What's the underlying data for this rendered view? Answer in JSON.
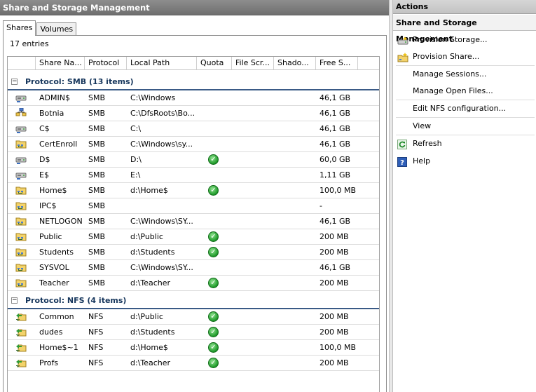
{
  "left_pane": {
    "title": "Share and Storage Management",
    "tabs": [
      {
        "label": "Shares",
        "active": true
      },
      {
        "label": "Volumes",
        "active": false
      }
    ],
    "entries_count": "17 entries"
  },
  "columns": [
    "Share Na...",
    "Protocol",
    "Local Path",
    "Quota",
    "File Scr...",
    "Shado...",
    "Free S..."
  ],
  "groups": [
    {
      "title": "Protocol: SMB (13 items)",
      "rows": [
        {
          "name": "ADMIN$",
          "protocol": "SMB",
          "path": "C:\\Windows",
          "quota": false,
          "free": "46,1 GB",
          "icon": "drive-share-icon"
        },
        {
          "name": "Botnia",
          "protocol": "SMB",
          "path": "C:\\DfsRoots\\Bo...",
          "quota": false,
          "free": "46,1 GB",
          "icon": "dfs-share-icon"
        },
        {
          "name": "C$",
          "protocol": "SMB",
          "path": "C:\\",
          "quota": false,
          "free": "46,1 GB",
          "icon": "drive-share-icon"
        },
        {
          "name": "CertEnroll",
          "protocol": "SMB",
          "path": "C:\\Windows\\sy...",
          "quota": false,
          "free": "46,1 GB",
          "icon": "folder-share-icon"
        },
        {
          "name": "D$",
          "protocol": "SMB",
          "path": "D:\\",
          "quota": true,
          "free": "60,0 GB",
          "icon": "drive-share-icon"
        },
        {
          "name": "E$",
          "protocol": "SMB",
          "path": "E:\\",
          "quota": false,
          "free": "1,11 GB",
          "icon": "drive-share-icon"
        },
        {
          "name": "Home$",
          "protocol": "SMB",
          "path": "d:\\Home$",
          "quota": true,
          "free": "100,0 MB",
          "icon": "folder-share-icon"
        },
        {
          "name": "IPC$",
          "protocol": "SMB",
          "path": "",
          "quota": false,
          "free": "-",
          "icon": "folder-share-icon"
        },
        {
          "name": "NETLOGON",
          "protocol": "SMB",
          "path": "C:\\Windows\\SY...",
          "quota": false,
          "free": "46,1 GB",
          "icon": "folder-share-icon"
        },
        {
          "name": "Public",
          "protocol": "SMB",
          "path": "d:\\Public",
          "quota": true,
          "free": "200 MB",
          "icon": "folder-share-icon"
        },
        {
          "name": "Students",
          "protocol": "SMB",
          "path": "d:\\Students",
          "quota": true,
          "free": "200 MB",
          "icon": "folder-share-icon"
        },
        {
          "name": "SYSVOL",
          "protocol": "SMB",
          "path": "C:\\Windows\\SY...",
          "quota": false,
          "free": "46,1 GB",
          "icon": "folder-share-icon"
        },
        {
          "name": "Teacher",
          "protocol": "SMB",
          "path": "d:\\Teacher",
          "quota": true,
          "free": "200 MB",
          "icon": "folder-share-icon"
        }
      ]
    },
    {
      "title": "Protocol: NFS (4 items)",
      "rows": [
        {
          "name": "Common",
          "protocol": "NFS",
          "path": "d:\\Public",
          "quota": true,
          "free": "200 MB",
          "icon": "nfs-share-icon"
        },
        {
          "name": "dudes",
          "protocol": "NFS",
          "path": "d:\\Students",
          "quota": true,
          "free": "200 MB",
          "icon": "nfs-share-icon"
        },
        {
          "name": "Home$~1",
          "protocol": "NFS",
          "path": "d:\\Home$",
          "quota": true,
          "free": "100,0 MB",
          "icon": "nfs-share-icon"
        },
        {
          "name": "Profs",
          "protocol": "NFS",
          "path": "d:\\Teacher",
          "quota": true,
          "free": "200 MB",
          "icon": "nfs-share-icon"
        }
      ]
    }
  ],
  "actions": {
    "title": "Actions",
    "section": "Share and Storage Management",
    "items": [
      {
        "label": "Provision Storage...",
        "icon": "provision-storage-icon"
      },
      {
        "label": "Provision Share...",
        "icon": "provision-share-icon"
      },
      {
        "label": "Manage Sessions...",
        "icon": ""
      },
      {
        "label": "Manage Open Files...",
        "icon": ""
      },
      {
        "label": "Edit NFS configuration...",
        "icon": ""
      },
      {
        "label": "View",
        "icon": ""
      },
      {
        "label": "Refresh",
        "icon": "refresh-icon"
      },
      {
        "label": "Help",
        "icon": "help-icon"
      }
    ]
  },
  "colors": {
    "group_title": "#16365c",
    "group_line": "#3a5a86",
    "quota_check": "#1f9a2a"
  }
}
